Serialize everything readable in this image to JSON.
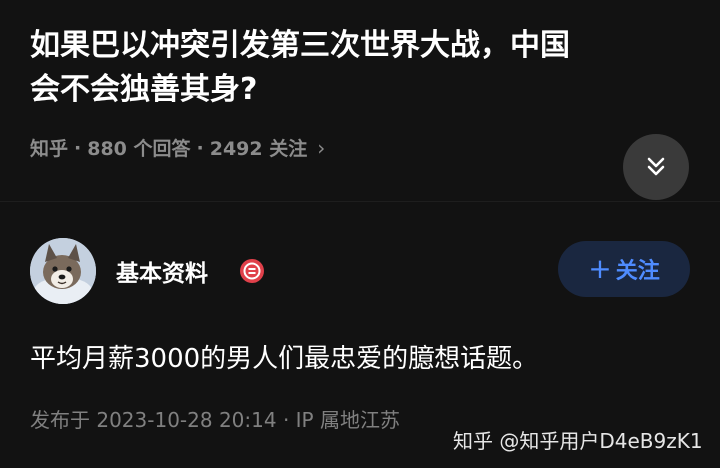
{
  "question": {
    "title": "如果巴以冲突引发第三次世界大战，中国\n会不会独善其身?",
    "source": "知乎",
    "answers_count": "880 个回答",
    "followers_count": "2492 关注",
    "separator": "·",
    "more_chevron": "›"
  },
  "author": {
    "name": "基本资料",
    "badge_icon": "certified-badge-icon",
    "follow_label": "关注",
    "follow_plus": "+"
  },
  "answer": {
    "text": "平均月薪3000的男人们最忠爱的臆想话题。",
    "meta": "发布于 2023-10-28 20:14 · IP 属地江苏"
  },
  "watermark": "知乎 @知乎用户D4eB9zK1",
  "colors": {
    "background": "#121212",
    "meta_text": "#8c8c8c",
    "follow_bg": "#1a2740",
    "follow_text": "#4f8cff",
    "badge_red": "#e0404a"
  }
}
